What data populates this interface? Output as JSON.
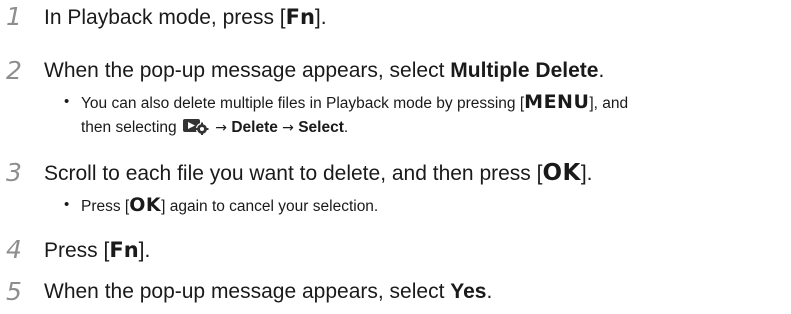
{
  "steps": [
    {
      "number": "1",
      "pre": "In Playback mode, press [",
      "key": "Fn",
      "post": "]."
    },
    {
      "number": "2",
      "pre": "When the pop-up message appears, select ",
      "bold": "Multiple Delete",
      "post": ".",
      "note": {
        "line1_pre": "You can also delete multiple files in Playback mode by pressing [",
        "line1_key": "MENU",
        "line1_post": "], and",
        "line2_pre": "then selecting",
        "line2_icon": "playback-settings-icon",
        "arrow1": "→",
        "bold1": "Delete",
        "arrow2": "→",
        "bold2": "Select",
        "line2_post": "."
      }
    },
    {
      "number": "3",
      "pre": "Scroll to each file you want to delete, and then press [",
      "key": "OK",
      "post": "].",
      "note": {
        "pre": "Press [",
        "key": "OK",
        "post": "] again to cancel your selection."
      }
    },
    {
      "number": "4",
      "pre": "Press [",
      "key": "Fn",
      "post": "]."
    },
    {
      "number": "5",
      "pre": "When the pop-up message appears, select ",
      "bold": "Yes",
      "post": "."
    }
  ],
  "bullet_char": "•",
  "colors": {
    "step_number": "#8e8e8e",
    "text": "#1a1a1a",
    "icon_body": "#333333"
  }
}
